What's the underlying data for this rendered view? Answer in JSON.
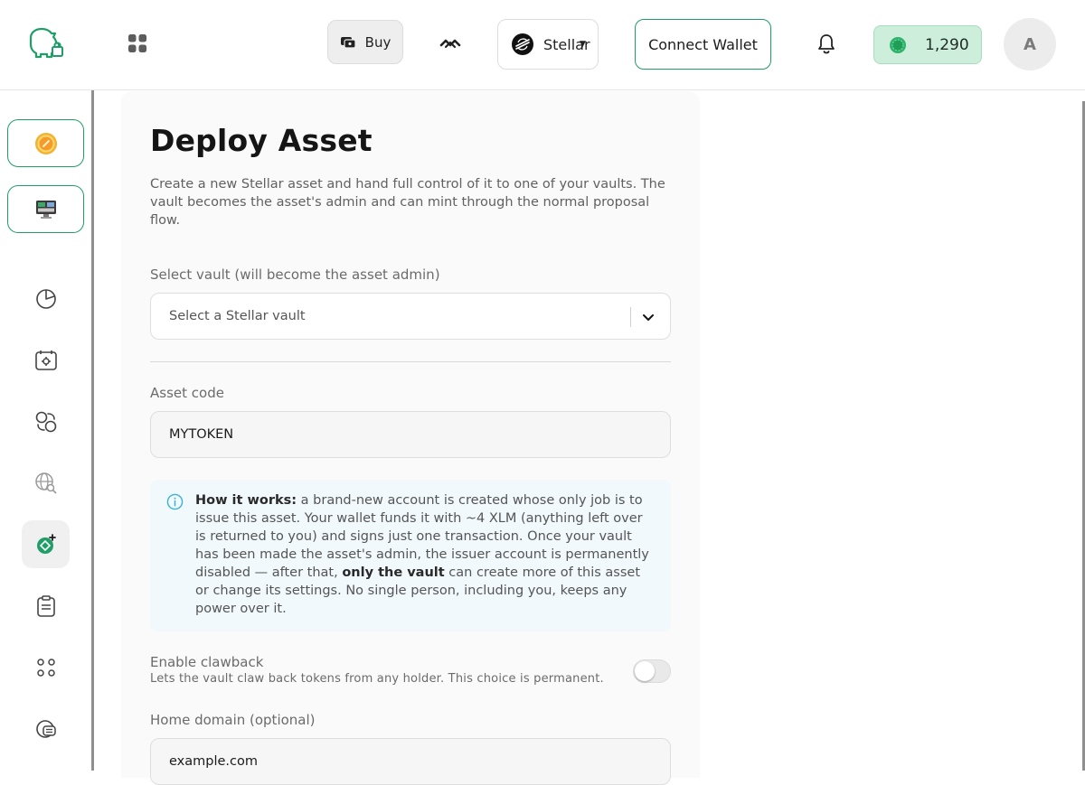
{
  "header": {
    "buy_label": "Buy",
    "network_label": "Stellar",
    "connect_label": "Connect Wallet",
    "points_value": "1,290",
    "avatar_initial": "A"
  },
  "sidebar": {
    "vault_tiles": [
      "vault-avatar-gold",
      "vault-avatar-screen"
    ],
    "nav_items": [
      "pie-chart-icon",
      "calendar-gear-icon",
      "swap-coins-icon",
      "globe-search-icon",
      "deploy-asset-icon",
      "clipboard-icon",
      "apps-dots-icon",
      "stack-coins-icon"
    ],
    "active_item": "deploy-asset-icon"
  },
  "page": {
    "title": "Deploy Asset",
    "description": "Create a new Stellar asset and hand full control of it to one of your vaults. The vault becomes the asset's admin and can mint through the normal proposal flow."
  },
  "vault_select": {
    "label": "Select vault (will become the asset admin)",
    "placeholder": "Select a Stellar vault"
  },
  "asset_code": {
    "label": "Asset code",
    "placeholder": "MYTOKEN"
  },
  "info": {
    "heading": "How it works:",
    "text_1": " a brand-new account is created whose only job is to issue this asset. Your wallet funds it with ~4 XLM (anything left over is returned to you) and signs just one transaction. Once your vault has been made the asset's admin, the issuer account is permanently disabled — after that, ",
    "emphasis": "only the vault",
    "text_2": " can create more of this asset or change its settings. No single person, including you, keeps any power over it."
  },
  "clawback": {
    "label": "Enable clawback",
    "help": "Lets the vault claw back tokens from any holder. This choice is permanent.",
    "enabled": false
  },
  "home_domain": {
    "label": "Home domain (optional)",
    "placeholder": "example.com"
  },
  "colors": {
    "accent": "#1f9e67",
    "points_bg": "#cdeedb",
    "info_bg": "#f1f9fc",
    "info_icon": "#3bb3d6"
  }
}
